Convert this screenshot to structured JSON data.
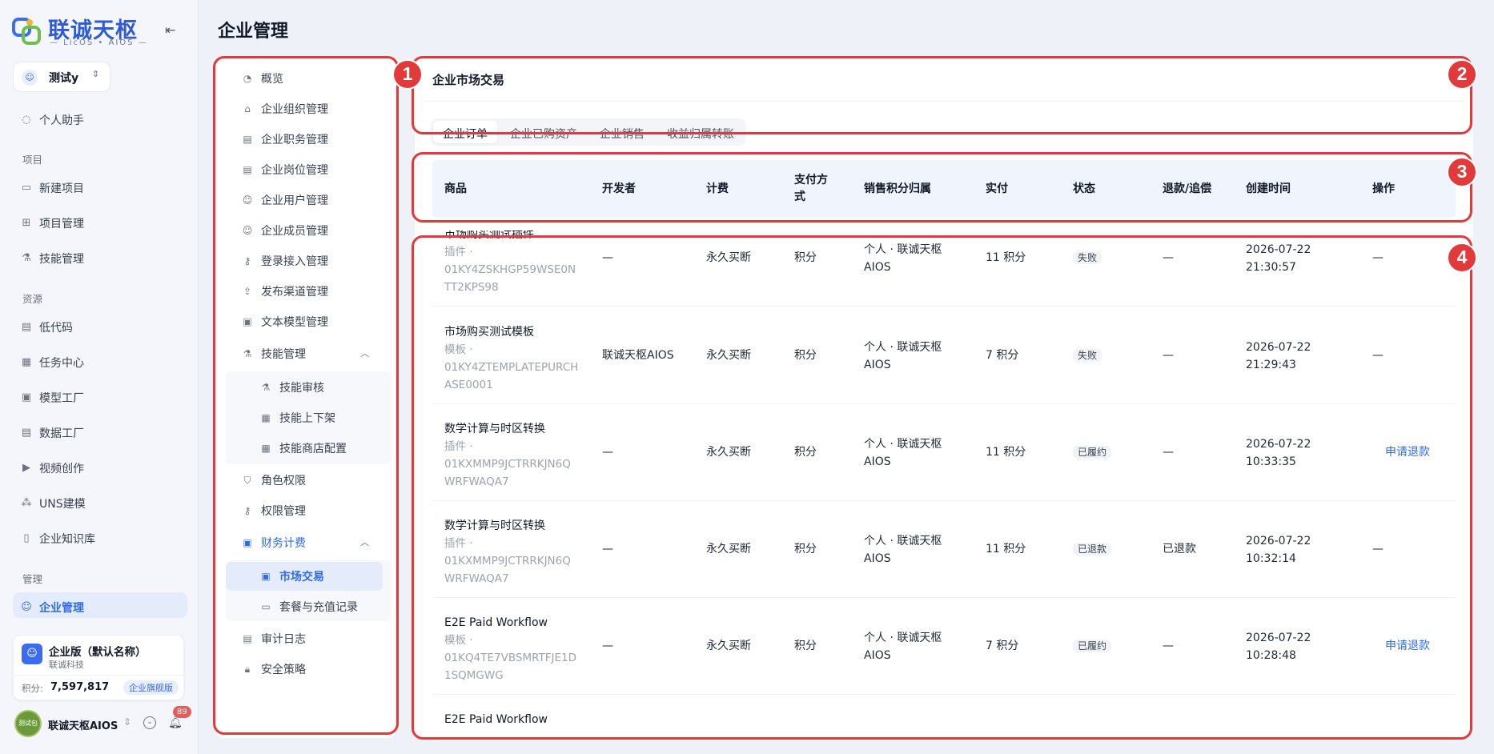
{
  "app": {
    "logo_title": "联诚天枢",
    "logo_subtitle": "— LicOS • AIOS —"
  },
  "workspace": {
    "label": "测试y"
  },
  "nav": {
    "assistant": "个人助手",
    "group_project": "项目",
    "new_project": "新建项目",
    "project_manage": "项目管理",
    "skill_manage": "技能管理",
    "group_resource": "资源",
    "low_code": "低代码",
    "task_center": "任务中心",
    "model_factory": "模型工厂",
    "data_factory": "数据工厂",
    "video_creation": "视频创作",
    "uns_modeling": "UNS建模",
    "knowledge_base": "企业知识库",
    "group_admin": "管理",
    "enterprise_manage": "企业管理"
  },
  "org": {
    "name": "企业版（默认名称）",
    "company": "联诚科技",
    "points_label": "积分:",
    "points": "7,597,817",
    "badge": "企业旗舰版"
  },
  "user": {
    "name": "联诚天枢AIOS",
    "avatar_text": "测试包",
    "notifications": "89"
  },
  "page_title": "企业管理",
  "submenu": {
    "overview": "概览",
    "org_structure": "企业组织管理",
    "duty": "企业职务管理",
    "position": "企业岗位管理",
    "users": "企业用户管理",
    "members": "企业成员管理",
    "login_access": "登录接入管理",
    "publish_channel": "发布渠道管理",
    "text_model": "文本模型管理",
    "skill_manage": "技能管理",
    "skill_review": "技能审核",
    "skill_listing": "技能上下架",
    "skill_store": "技能商店配置",
    "roles": "角色权限",
    "permissions": "权限管理",
    "finance": "财务计费",
    "market_trade": "市场交易",
    "plans": "套餐与充值记录",
    "audit_log": "审计日志",
    "security": "安全策略"
  },
  "main": {
    "title": "企业市场交易",
    "tabs": [
      "企业订单",
      "企业已购资产",
      "企业销售",
      "收益归属转账"
    ],
    "columns": {
      "product": "商品",
      "developer": "开发者",
      "billing": "计费",
      "pay_line1": "支付方",
      "pay_line2": "式",
      "attribution": "销售积分归属",
      "paid": "实付",
      "status": "状态",
      "refund": "退款/追偿",
      "created": "创建时间",
      "action": "操作"
    },
    "rows": [
      {
        "name": "市场购买测试插件",
        "type": "插件 ·",
        "id": "01KY4ZSKHGP59WSE0NTT2KPS98",
        "developer": "—",
        "billing": "永久买断",
        "pay": "积分",
        "attr1": "个人 · 联诚天枢",
        "attr2": "AIOS",
        "paid": "11 积分",
        "status": "失败",
        "refund": "—",
        "date": "2026-07-22",
        "time": "21:30:57",
        "action": "—"
      },
      {
        "name": "市场购买测试模板",
        "type": "模板 ·",
        "id": "01KY4ZTEMPLATEPURCHASE0001",
        "developer": "联诚天枢AIOS",
        "billing": "永久买断",
        "pay": "积分",
        "attr1": "个人 · 联诚天枢",
        "attr2": "AIOS",
        "paid": "7 积分",
        "status": "失败",
        "refund": "—",
        "date": "2026-07-22",
        "time": "21:29:43",
        "action": "—"
      },
      {
        "name": "数学计算与时区转换",
        "type": "插件 ·",
        "id": "01KXMMP9JCTRRKJN6QWRFWAQA7",
        "developer": "—",
        "billing": "永久买断",
        "pay": "积分",
        "attr1": "个人 · 联诚天枢",
        "attr2": "AIOS",
        "paid": "11 积分",
        "status": "已履约",
        "refund": "—",
        "date": "2026-07-22",
        "time": "10:33:35",
        "action": "申请退款"
      },
      {
        "name": "数学计算与时区转换",
        "type": "插件 ·",
        "id": "01KXMMP9JCTRRKJN6QWRFWAQA7",
        "developer": "—",
        "billing": "永久买断",
        "pay": "积分",
        "attr1": "个人 · 联诚天枢",
        "attr2": "AIOS",
        "paid": "11 积分",
        "status": "已退款",
        "refund": "已退款",
        "date": "2026-07-22",
        "time": "10:32:14",
        "action": "—"
      },
      {
        "name": "E2E Paid Workflow",
        "type": "模板 ·",
        "id": "01KQ4TE7VBSMRTFJE1D1SQMGWG",
        "developer": "—",
        "billing": "永久买断",
        "pay": "积分",
        "attr1": "个人 · 联诚天枢",
        "attr2": "AIOS",
        "paid": "7 积分",
        "status": "已履约",
        "refund": "—",
        "date": "2026-07-22",
        "time": "10:28:48",
        "action": "申请退款"
      },
      {
        "name": "E2E Paid Workflow",
        "type": "",
        "id": "",
        "developer": "",
        "billing": "",
        "pay": "",
        "attr1": "",
        "attr2": "",
        "paid": "",
        "status": "",
        "refund": "",
        "date": "",
        "time": "",
        "action": ""
      }
    ]
  },
  "markers": [
    "1",
    "2",
    "3",
    "4"
  ],
  "colors": {
    "annotation": "#e23a3a",
    "accent": "#2f6bec"
  }
}
